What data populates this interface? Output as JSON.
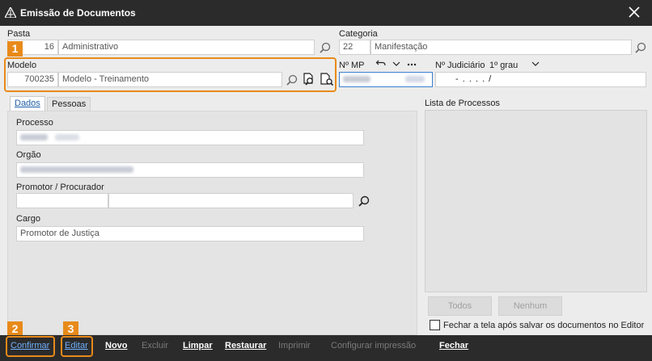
{
  "window": {
    "title": "Emissão de Documentos"
  },
  "pasta": {
    "label": "Pasta",
    "code": "16",
    "name": "Administrativo"
  },
  "categoria": {
    "label": "Categoria",
    "code": "22",
    "name": "Manifestação"
  },
  "modelo": {
    "label": "Modelo",
    "code": "700235",
    "name": "Modelo - Treinamento"
  },
  "nmp": {
    "label": "Nº MP"
  },
  "judiciario": {
    "label": "Nº Judiciário",
    "grau": "1º grau",
    "value": "- .    . . .    /"
  },
  "tabs": [
    {
      "label": "Dados",
      "active": true
    },
    {
      "label": "Pessoas",
      "active": false
    }
  ],
  "dados": {
    "processo_label": "Processo",
    "orgao_label": "Orgão",
    "promotor_label": "Promotor / Procurador",
    "cargo_label": "Cargo",
    "cargo_value": "Promotor de Justiça"
  },
  "lista": {
    "label": "Lista de Processos",
    "todos": "Todos",
    "nenhum": "Nenhum",
    "fechar_checkbox": "Fechar a tela após salvar os documentos no Editor"
  },
  "callouts": [
    "1",
    "2",
    "3"
  ],
  "bottom_bar": {
    "confirmar": "Confirmar",
    "editar": "Editar",
    "novo": "Novo",
    "excluir": "Excluir",
    "limpar": "Limpar",
    "restaurar": "Restaurar",
    "imprimir": "Imprimir",
    "configurar": "Configurar impressão",
    "fechar": "Fechar"
  },
  "colors": {
    "titlebar": "#2b2b2b",
    "accent_orange": "#e88a1a",
    "link_blue": "#6fb1ff",
    "tab_blue": "#1f5fa8"
  }
}
